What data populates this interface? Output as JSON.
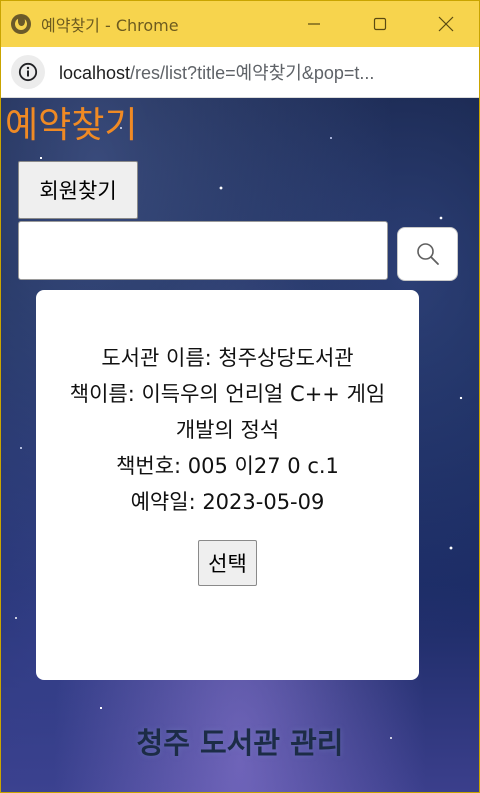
{
  "window": {
    "title": "예약찾기 - Chrome",
    "accent_color": "#f7d44d",
    "controls": [
      "minimize-icon",
      "maximize-icon",
      "close-icon"
    ]
  },
  "addressbar": {
    "info_icon": "info-icon",
    "url_host": "localhost",
    "url_path": "/res/list?title=예약찾기&pop=t..."
  },
  "page": {
    "title": "예약찾기",
    "title_color": "#f08a24",
    "member_button_label": "회원찾기",
    "search": {
      "value": "",
      "placeholder": "",
      "button_icon": "search-icon"
    },
    "result": {
      "library_line": "도서관 이름: 청주상당도서관",
      "book_line": "책이름: 이득우의 언리얼 C++ 게임 개발의 정석",
      "book_number_line": "책번호: 005 이27 0 c.1",
      "reserve_date_line": "예약일: 2023-05-09",
      "select_button_label": "선택"
    },
    "footer": "청주 도서관 관리"
  }
}
